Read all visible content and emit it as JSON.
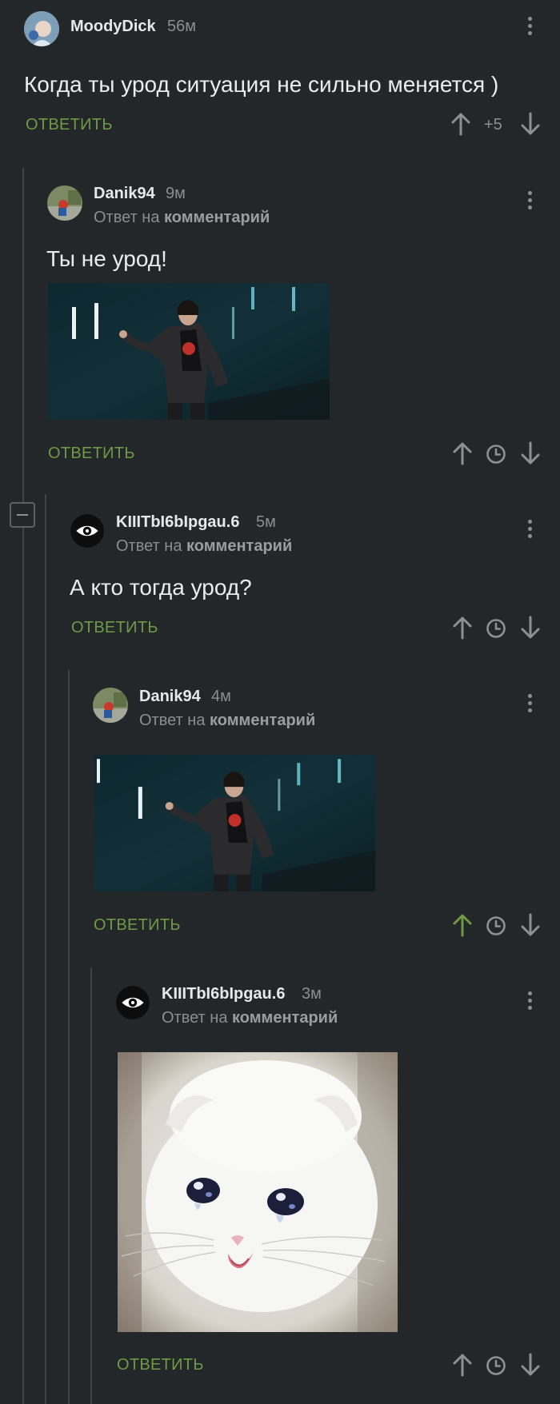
{
  "reply_label": "ОТВЕТИТЬ",
  "reply_to_prefix": "Ответ на",
  "reply_to_target": "комментарий",
  "colors": {
    "background": "#23272a",
    "accent_green": "#6e9a45",
    "muted_text": "#8a8e91",
    "thread_line": "#3e4448"
  },
  "comments": [
    {
      "author": "MoodyDick",
      "time": "56м",
      "text": "Когда ты урод ситуация не сильно меняется )",
      "rating": "+5",
      "avatar_icon": "child-photo-avatar"
    },
    {
      "author": "Danik94",
      "time": "9м",
      "text": "Ты не урод!",
      "media": "keanu-pointing-gif",
      "avatar_icon": "photo-avatar"
    },
    {
      "author": "KIIITbI6bIpgau.6",
      "time": "5м",
      "text": "А кто тогда урод?",
      "avatar_icon": "eye-avatar"
    },
    {
      "author": "Danik94",
      "time": "4м",
      "media": "keanu-pointing-gif",
      "avatar_icon": "photo-avatar",
      "upvoted": true
    },
    {
      "author": "KIIITbI6bIpgau.6",
      "time": "3м",
      "media": "crying-cat-image",
      "avatar_icon": "eye-avatar"
    }
  ]
}
